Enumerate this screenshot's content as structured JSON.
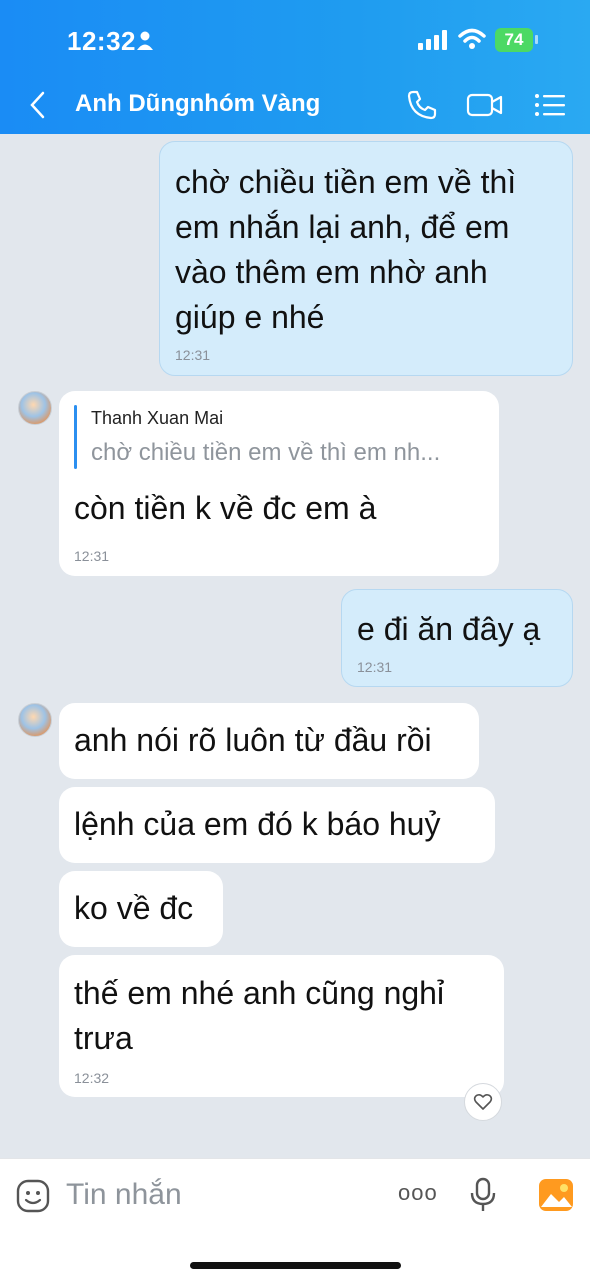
{
  "status_bar": {
    "time": "12:32",
    "battery": "74"
  },
  "header": {
    "title": "Anh Dũngnhóm Vàng"
  },
  "messages": [
    {
      "lines": [
        "chờ chiều tiền em về thì",
        "em nhắn lại anh,  để em",
        "vào thêm em nhờ anh",
        "giúp e nhé"
      ],
      "time": "12:31"
    },
    {
      "quote_author": "Thanh Xuan Mai",
      "quote_text": "chờ chiều tiền em về thì em nh...",
      "text": "còn tiền k về đc em à",
      "time": "12:31"
    },
    {
      "text": "e đi ăn đây ạ",
      "time": "12:31"
    },
    {
      "text": "anh nói rõ luôn từ đầu rồi"
    },
    {
      "text": "lệnh của em đó k báo huỷ"
    },
    {
      "text": "ko về đc"
    },
    {
      "lines": [
        "thế em nhé anh cũng nghỉ",
        "trưa"
      ],
      "time": "12:32"
    }
  ],
  "composer": {
    "placeholder": "Tin nhắn",
    "more_label": "ooo"
  },
  "icons": {
    "back": "chevron-left-icon",
    "call": "phone-icon",
    "video": "video-icon",
    "menu": "list-icon",
    "emoji": "emoji-icon",
    "mic": "mic-icon",
    "image": "image-icon",
    "heart": "heart-icon"
  }
}
